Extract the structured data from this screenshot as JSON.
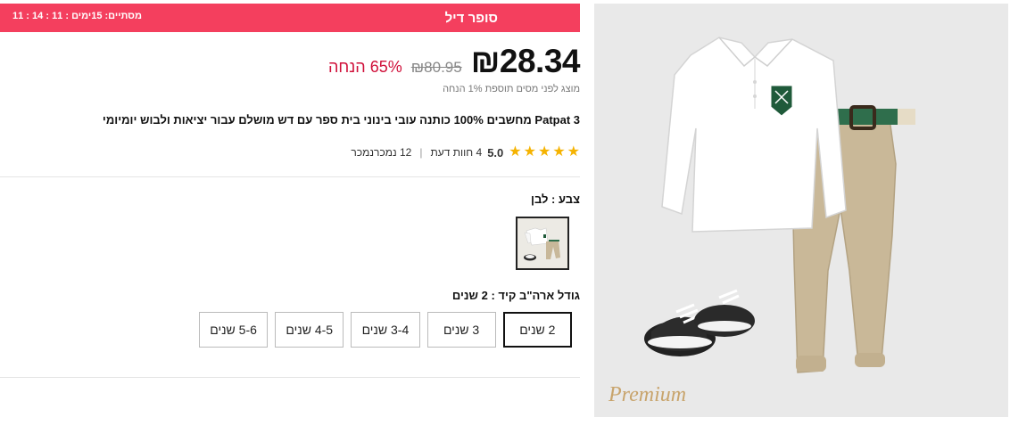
{
  "deal": {
    "title": "סופר דיל",
    "countdown": "מסתיים: 15ימים : 11 : 14 : 11",
    "accent_color": "#f43f5e"
  },
  "pricing": {
    "price": "₪28.34",
    "old_price": "₪80.95",
    "discount": "65% הנחה",
    "tax_note": "מוצג לפני מסים תוספת 1% הנחה"
  },
  "product": {
    "title": "Patpat 3 מחשבים 100% כותנה עובי בינוני בית ספר עם דש מושלם עבור יציאות ולבוש יומיומי",
    "rating": {
      "stars": 5,
      "value": "5.0",
      "reviews": "4 חוות דעת",
      "sold": "12 נמכרנמכר"
    }
  },
  "color": {
    "label": "צבע : לבן"
  },
  "size": {
    "label": "גודל ארה\"ב קיד : 2 שנים",
    "options": [
      "2 שנים",
      "3 שנים",
      "3-4 שנים",
      "4-5 שנים",
      "5-6 שנים"
    ],
    "selected_index": 0
  },
  "image": {
    "badge": "Premium"
  }
}
